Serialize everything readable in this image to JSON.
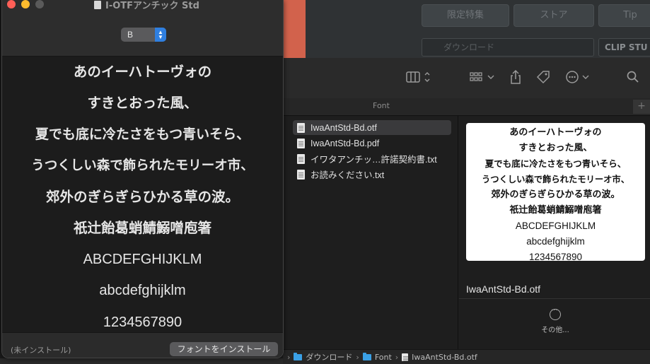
{
  "font_book": {
    "title": "I-OTFアンチック Std",
    "style_value": "B",
    "sample_lines": [
      "あのイーハトーヴォの",
      "すきとおった風、",
      "夏でも底に冷たさをもつ青いそら、",
      "うつくしい森で飾られたモリーオ市、",
      "郊外のぎらぎらひかる草の波。",
      "祇辻飴葛蛸鯖鰯噌庖箸",
      "ABCDEFGHIJKLM",
      "abcdefghijklm",
      "1234567890"
    ],
    "status": "(未インストール)",
    "install_button": "フォントをインストール"
  },
  "finder": {
    "column_header": "Font",
    "files": [
      {
        "name": "IwaAntStd-Bd.otf",
        "selected": true
      },
      {
        "name": "IwaAntStd-Bd.pdf",
        "selected": false
      },
      {
        "name": "イワタアンチッ…許諾契約書.txt",
        "selected": false
      },
      {
        "name": "お読みください.txt",
        "selected": false
      }
    ],
    "preview_lines": [
      "あのイーハトーヴォの",
      "すきとおった風、",
      "夏でも底に冷たさをもつ青いそら、",
      "うつくしい森で飾られたモリーオ市、",
      "郊外のぎらぎらひかる草の波。",
      "祇辻飴葛蛸鯖鰯噌庖箸",
      "ABCDEFGHIJKLM",
      "abcdefghijklm",
      "1234567890"
    ],
    "preview_filename": "IwaAntStd-Bd.otf",
    "more_label": "その他...",
    "path": [
      "ダウンロード",
      "Font",
      "IwaAntStd-Bd.otf"
    ]
  },
  "background": {
    "tab_1": "限定特集",
    "tab_2": "ストア",
    "tab_3": "Tip",
    "field_1": "ダウンロード",
    "field_2": "CLIP STU"
  },
  "colors": {
    "traffic_close": "#ff5f57",
    "traffic_min": "#febc2e",
    "traffic_max": "#5a5a5a",
    "accent": "#2f7fe0",
    "folder": "#3aa0e6"
  }
}
